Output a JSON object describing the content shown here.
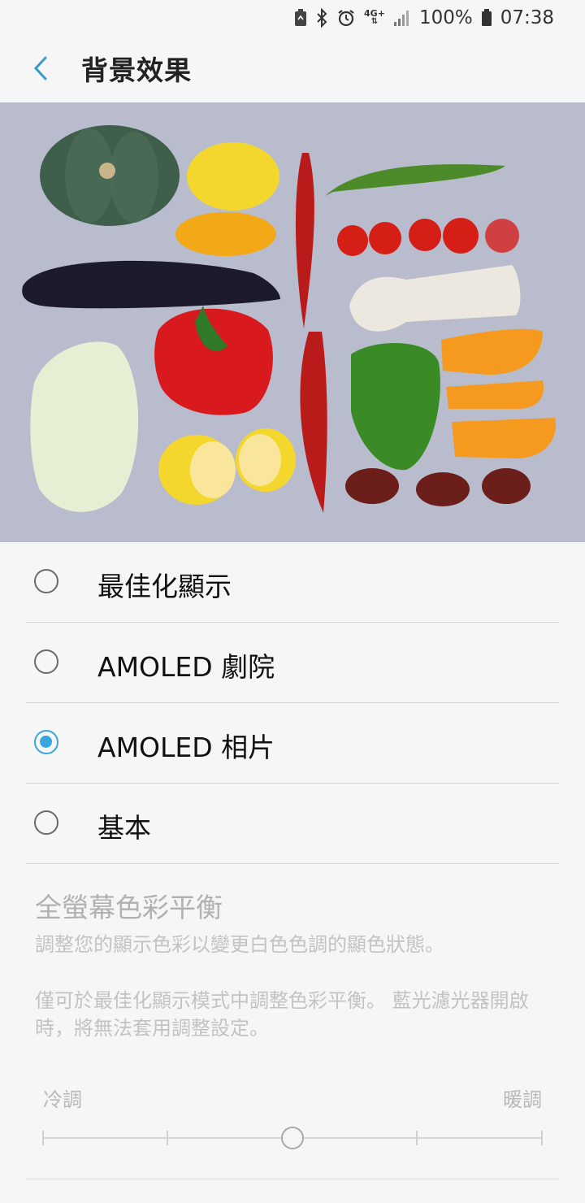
{
  "status": {
    "network": "4G+",
    "battery": "100%",
    "time": "07:38"
  },
  "header": {
    "title": "背景效果"
  },
  "options": [
    {
      "label": "最佳化顯示",
      "selected": false
    },
    {
      "label": "AMOLED 劇院",
      "selected": false
    },
    {
      "label": "AMOLED 相片",
      "selected": true
    },
    {
      "label": "基本",
      "selected": false
    }
  ],
  "color_balance": {
    "title": "全螢幕色彩平衡",
    "description": "調整您的顯示色彩以變更白色色調的顯色狀態。",
    "note": "僅可於最佳化顯示模式中調整色彩平衡。 藍光濾光器開啟時，將無法套用調整設定。",
    "cool_label": "冷調",
    "warm_label": "暖調",
    "slider_value": 0.5
  },
  "colors": {
    "accent": "#3aa5dc"
  }
}
